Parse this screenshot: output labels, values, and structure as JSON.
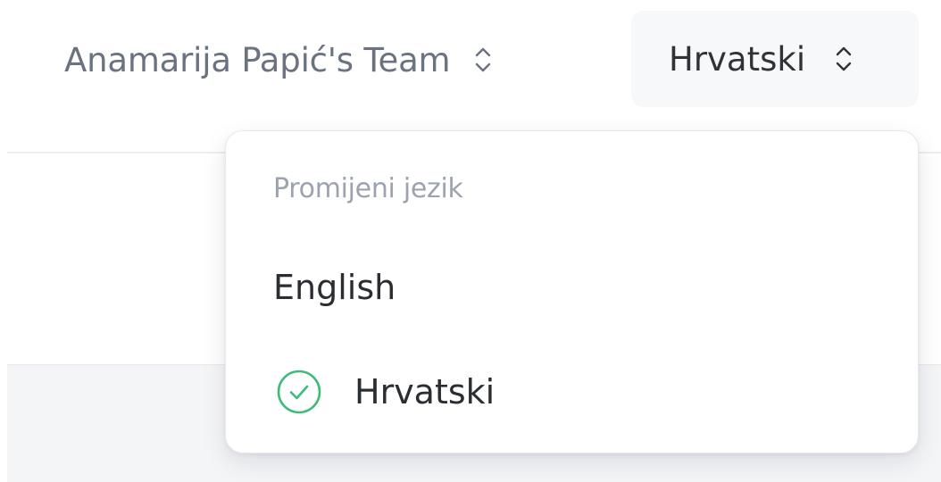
{
  "header": {
    "team_name": "Anamarija Papić's Team",
    "current_language": "Hrvatski"
  },
  "language_menu": {
    "heading": "Promijeni jezik",
    "options": [
      {
        "label": "English",
        "selected": false
      },
      {
        "label": "Hrvatski",
        "selected": true
      }
    ],
    "check_icon": "check-circle-icon",
    "check_color": "#3dbb7a"
  },
  "icons": {
    "switcher_icon": "chevron-up-down-icon"
  },
  "colors": {
    "text_muted": "#6b7280",
    "text_primary": "#2f3338",
    "heading_color": "#9ca3af",
    "switcher_bg": "#f7f8fa"
  }
}
